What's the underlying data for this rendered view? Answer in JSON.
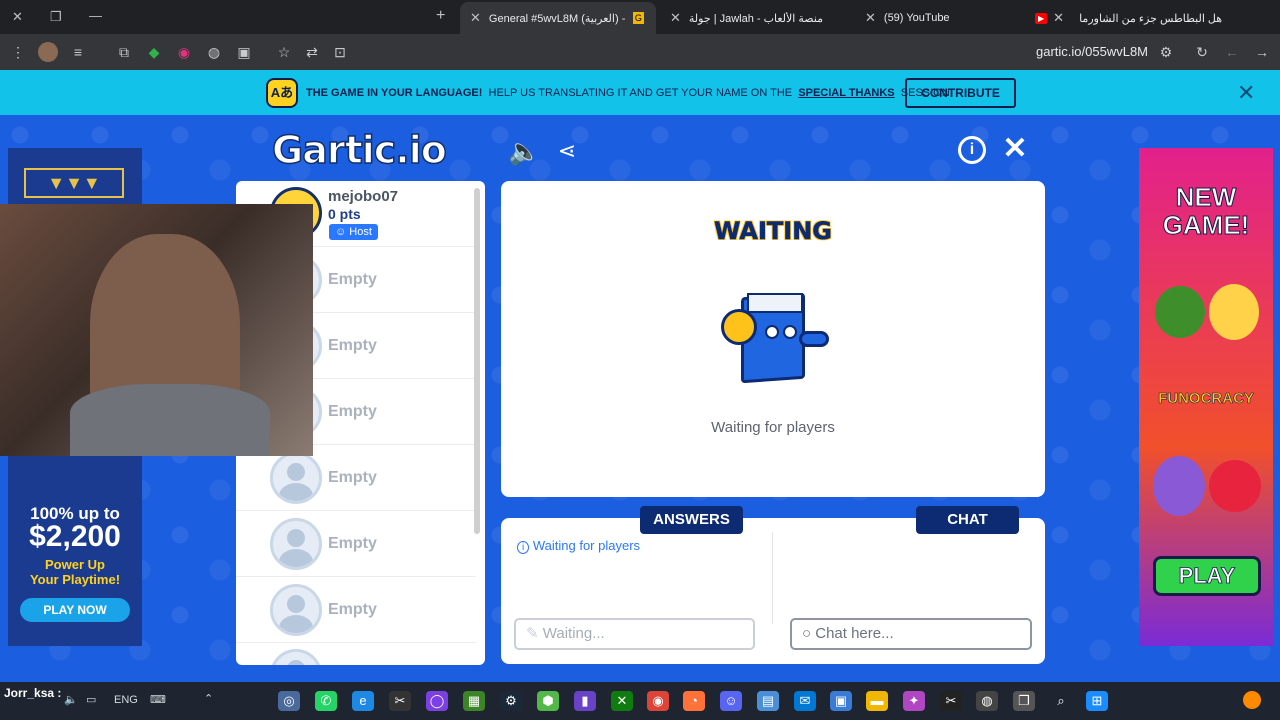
{
  "tabs": [
    {
      "label": "هل البطاطس جزء من الشاورما"
    },
    {
      "label": "(59) YouTube"
    },
    {
      "label": "جولة | Jawlah - منصة الألعاب"
    },
    {
      "label": "General #5wvL8M (العربية) - Ga"
    }
  ],
  "url": "gartic.io/055wvL8M",
  "banner": {
    "lead": "THE GAME IN YOUR LANGUAGE!",
    "text": "HELP US TRANSLATING IT AND GET YOUR NAME ON THE",
    "link": "SPECIAL THANKS",
    "tail": "SESSION",
    "button": "CONTRIBUTE"
  },
  "logo": "Gartic.io",
  "player": {
    "name": "mejobo07",
    "points": "0 pts",
    "badge": "Host"
  },
  "empty_slots": [
    "Empty",
    "Empty",
    "Empty",
    "Empty",
    "Empty",
    "Empty"
  ],
  "stage": {
    "title": "WAITING",
    "message": "Waiting for players"
  },
  "answers": {
    "tab": "ANSWERS",
    "info": "Waiting for players",
    "input_placeholder": "Waiting..."
  },
  "chat": {
    "tab": "CHAT",
    "input_placeholder": "Chat here..."
  },
  "ad_left": {
    "headline": "100% up to",
    "amount": "$2,200",
    "sub1": "Power Up",
    "sub2": "Your Playtime!",
    "cta": "PLAY NOW"
  },
  "ad_right": {
    "headline1": "NEW",
    "headline2": "GAME!",
    "brand": "FUNOCRACY",
    "cta": "PLAY"
  },
  "taskbar": {
    "lang": "ENG",
    "user": "Jorr_ksa :"
  },
  "colors": {
    "accent": "#13c2e8",
    "navy": "#0d2b73",
    "game_bg": "#1c5ee0"
  }
}
